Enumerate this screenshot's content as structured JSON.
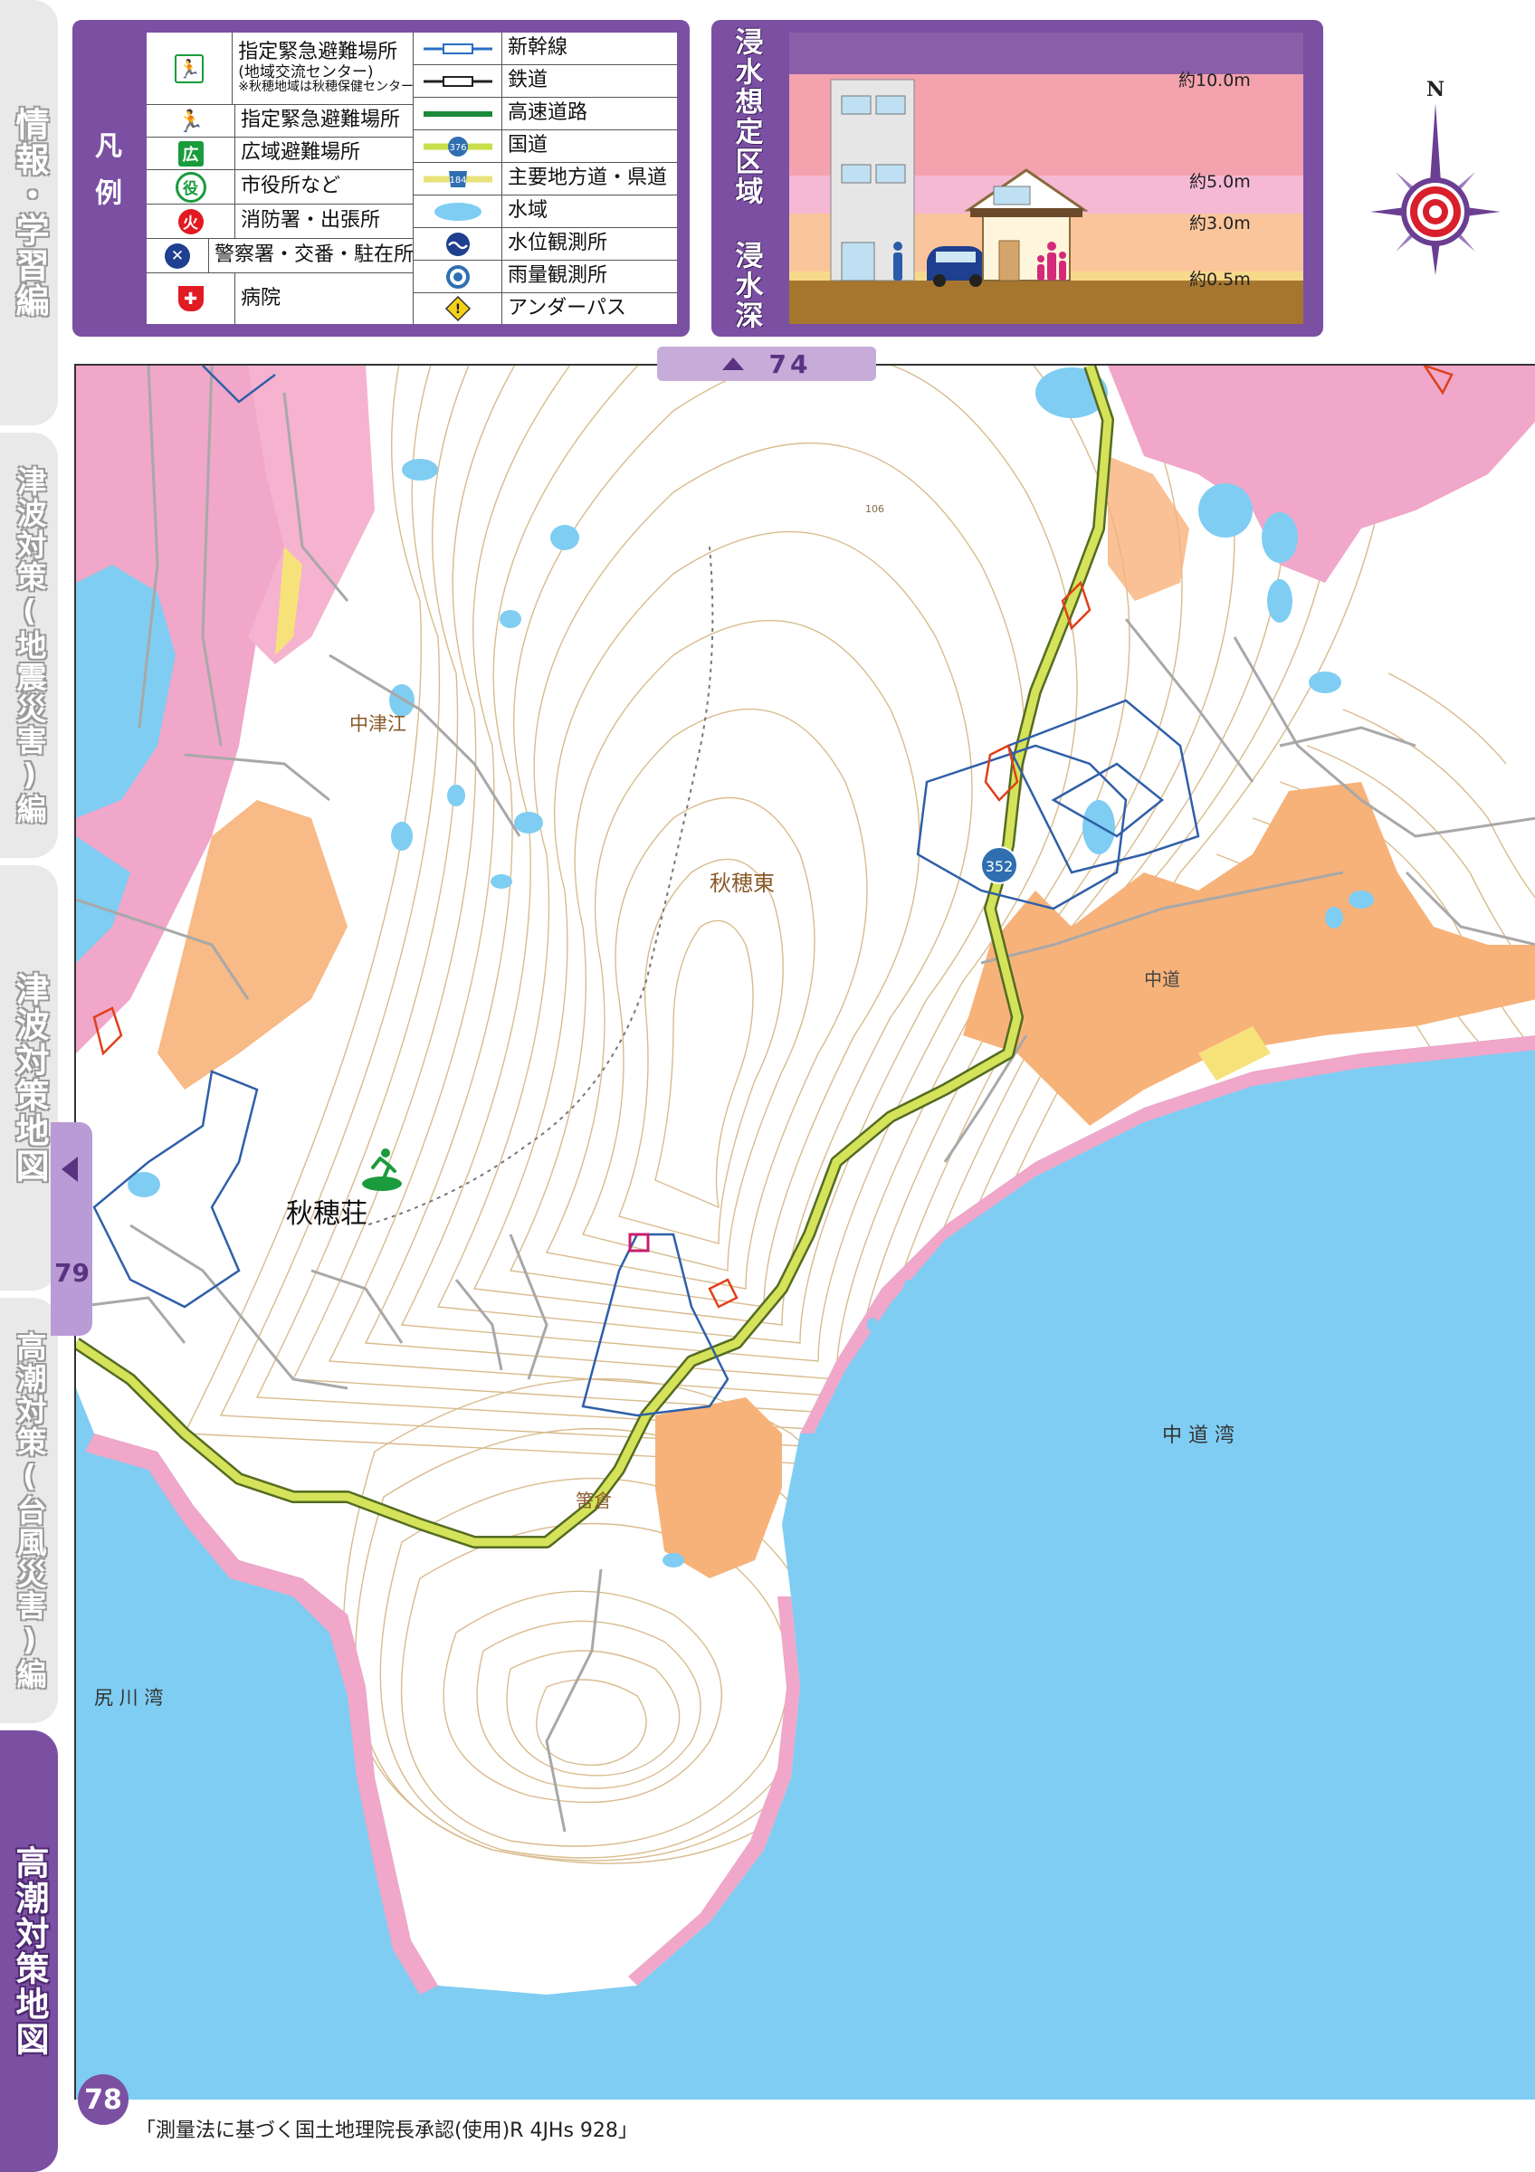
{
  "side_tabs": [
    {
      "label": "情報・学習編"
    },
    {
      "label": "津波対策(地震災害)編"
    },
    {
      "label": "津波対策地図"
    },
    {
      "label": "高潮対策(台風災害)編"
    },
    {
      "label": "高潮対策地図"
    }
  ],
  "nav": {
    "prev_page": "79",
    "up_page": "74"
  },
  "legend": {
    "title": "凡例",
    "left": [
      {
        "icon": "evac-running-person-icon",
        "label": "指定緊急避難場所",
        "label2": "(地域交流センター)",
        "note": "※秋穂地域は秋穂保健センター"
      },
      {
        "icon": "evac-person-icon",
        "label": "指定緊急避難場所"
      },
      {
        "icon": "wide-area-evac-icon",
        "glyph": "広",
        "label": "広域避難場所"
      },
      {
        "icon": "city-hall-icon",
        "glyph": "役",
        "label": "市役所など"
      },
      {
        "icon": "fire-station-icon",
        "glyph": "火",
        "label": "消防署・出張所"
      },
      {
        "icon": "police-icon",
        "glyph": "✕",
        "label": "警察署・交番・駐在所"
      },
      {
        "icon": "hospital-icon",
        "glyph": "✚",
        "label": "病院"
      }
    ],
    "right": [
      {
        "icon": "shinkansen-line-icon",
        "label": "新幹線"
      },
      {
        "icon": "railway-line-icon",
        "label": "鉄道"
      },
      {
        "icon": "expressway-line-icon",
        "label": "高速道路"
      },
      {
        "icon": "national-road-icon",
        "glyph": "376",
        "label": "国道"
      },
      {
        "icon": "prefectural-road-icon",
        "glyph": "184",
        "label": "主要地方道・県道"
      },
      {
        "icon": "water-area-icon",
        "label": "水域"
      },
      {
        "icon": "water-level-station-icon",
        "label": "水位観測所"
      },
      {
        "icon": "rain-gauge-icon",
        "label": "雨量観測所"
      },
      {
        "icon": "underpass-icon",
        "label": "アンダーパス"
      }
    ],
    "colors": {
      "purple": "#7b4fa2",
      "green": "#1a9b3c",
      "red": "#e21a22",
      "blue": "#1f3f8f"
    }
  },
  "flood_depth": {
    "title": "浸水想定区域 浸水深",
    "levels": [
      "約10.0m",
      "約5.0m",
      "約3.0m",
      "約0.5m"
    ],
    "colors": [
      "#8b5ea8",
      "#f3a2ae",
      "#f5b9d4",
      "#fac59b",
      "#f7d98c",
      "#a6762f"
    ]
  },
  "map": {
    "places": {
      "nakatsue": "中津江",
      "aiohigashi": "秋穂東",
      "nakamichi": "中道",
      "nakamichi_bay": "中 道 湾",
      "shirikawa_bay": "尻 川 湾",
      "hashikura": "筈倉",
      "aioso": "秋穂荘"
    },
    "route_number": "352",
    "elevation": "106",
    "colors": {
      "sea": "#7fcdf2",
      "pink": "#f0a7c9",
      "orange": "#f7b27a",
      "road": "#c8de4a",
      "contour": "#c9a56c",
      "boundary": "#2f5fa8"
    }
  },
  "compass": {
    "north": "N"
  },
  "page_number": "78",
  "credit": "「測量法に基づく国土地理院長承認(使用)R 4JHs 928」"
}
